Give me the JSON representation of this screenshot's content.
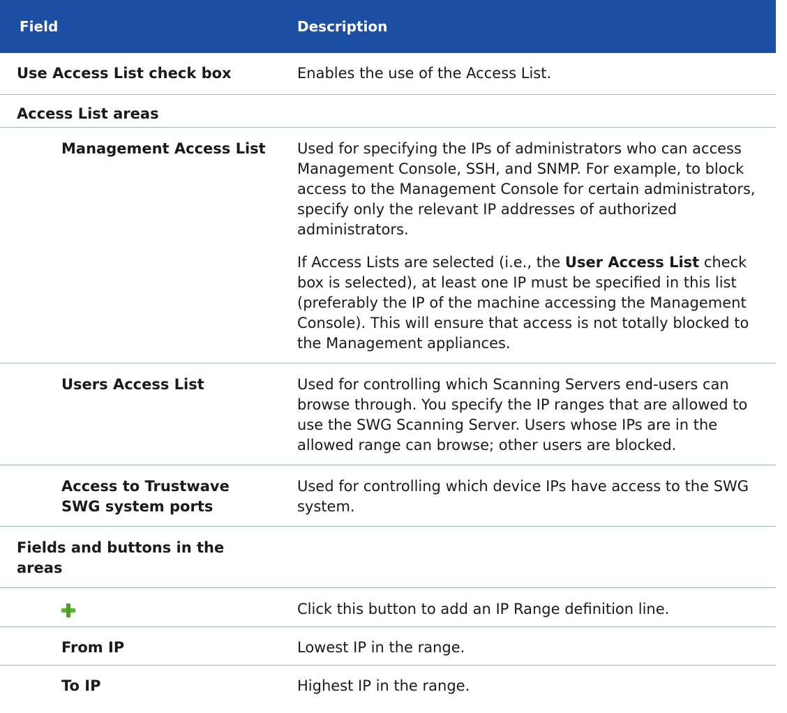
{
  "table": {
    "header": {
      "field": "Field",
      "description": "Description"
    },
    "use_access_list": {
      "field": "Use Access List check box",
      "description": "Enables the use of the Access List."
    },
    "access_list_areas": {
      "field": "Access List areas"
    },
    "management_access_list": {
      "field": "Management Access List",
      "description_p1": "Used for specifying the IPs of administrators who can access Management Console, SSH, and SNMP. For example, to block access to the Management Console for certain administrators, specify only the relevant IP addresses of authorized administrators.",
      "description_p2_before": "If Access Lists are selected (i.e., the ",
      "description_p2_bold": "User Access List",
      "description_p2_after": " check box is selected), at least one IP must be specified in this list (preferably the IP of the machine accessing the Management Console). This will ensure that access is not totally blocked to the Management appliances."
    },
    "users_access_list": {
      "field": "Users Access List",
      "description": "Used for controlling which Scanning Servers end-users can browse through. You specify the IP ranges that are allowed to use the SWG Scanning Server. Users whose IPs are in the allowed range can browse; other users are blocked."
    },
    "system_ports": {
      "field": "Access to Trustwave SWG system ports",
      "description": "Used for controlling which device IPs have access to the SWG system."
    },
    "fields_and_buttons": {
      "field": "Fields and buttons in the areas"
    },
    "add_button": {
      "icon": "plus-icon",
      "description": "Click this button to add an IP Range definition line."
    },
    "from_ip": {
      "field": "From IP",
      "description": "Lowest IP in the range."
    },
    "to_ip": {
      "field": "To IP",
      "description": "Highest IP in the range."
    }
  },
  "colors": {
    "header_bg": "#1c4fa3",
    "header_text": "#ffffff",
    "row_border": "#a9b4c8",
    "plus_icon": "#57b52e"
  }
}
